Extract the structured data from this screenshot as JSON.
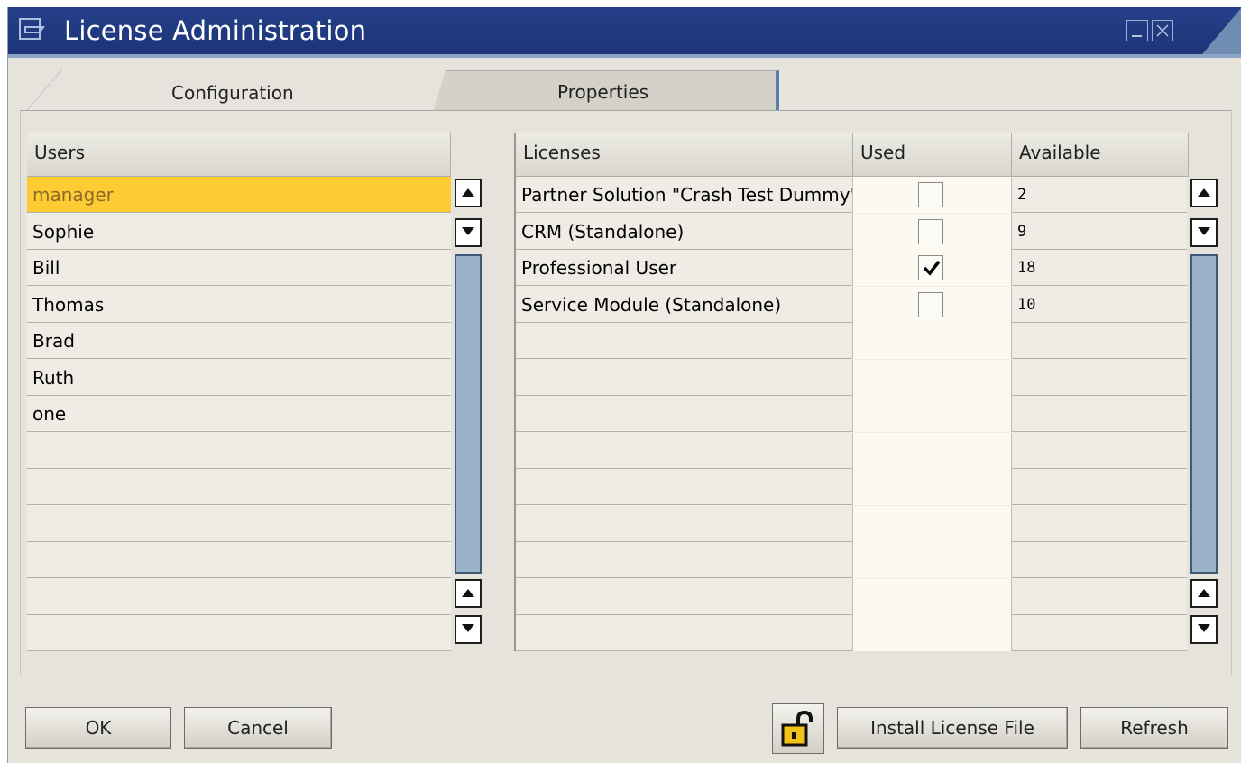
{
  "window": {
    "title": "License Administration"
  },
  "tabs": [
    {
      "label": "Configuration",
      "active": true
    },
    {
      "label": "Properties",
      "active": false
    }
  ],
  "users": {
    "header": "Users",
    "rows": [
      "manager",
      "Sophie",
      "Bill",
      "Thomas",
      "Brad",
      "Ruth",
      "one",
      "",
      "",
      "",
      "",
      "",
      ""
    ],
    "selected": "manager"
  },
  "licenses": {
    "columns": [
      "Licenses",
      "Used",
      "Available"
    ],
    "rows": [
      {
        "name": "Partner Solution \"Crash Test Dummy\"",
        "used": false,
        "available": "2"
      },
      {
        "name": "CRM (Standalone)",
        "used": false,
        "available": "9"
      },
      {
        "name": "Professional User",
        "used": true,
        "available": "18"
      },
      {
        "name": "Service Module (Standalone)",
        "used": false,
        "available": "10"
      },
      {
        "name": "",
        "used": null,
        "available": ""
      },
      {
        "name": "",
        "used": null,
        "available": ""
      },
      {
        "name": "",
        "used": null,
        "available": ""
      },
      {
        "name": "",
        "used": null,
        "available": ""
      },
      {
        "name": "",
        "used": null,
        "available": ""
      },
      {
        "name": "",
        "used": null,
        "available": ""
      },
      {
        "name": "",
        "used": null,
        "available": ""
      },
      {
        "name": "",
        "used": null,
        "available": ""
      },
      {
        "name": "",
        "used": null,
        "available": ""
      }
    ]
  },
  "buttons": {
    "ok": "OK",
    "cancel": "Cancel",
    "install": "Install License File",
    "refresh": "Refresh"
  },
  "icons": {
    "title": "form-icon",
    "minimize": "minimize-icon",
    "close": "close-icon",
    "lock": "unlock-icon",
    "scroll_up": "arrow-up-icon",
    "scroll_down": "arrow-down-icon"
  },
  "colors": {
    "titlebar": "#1e367c",
    "selection": "#fdcc33",
    "scrollbar": "#9ab3c9"
  }
}
